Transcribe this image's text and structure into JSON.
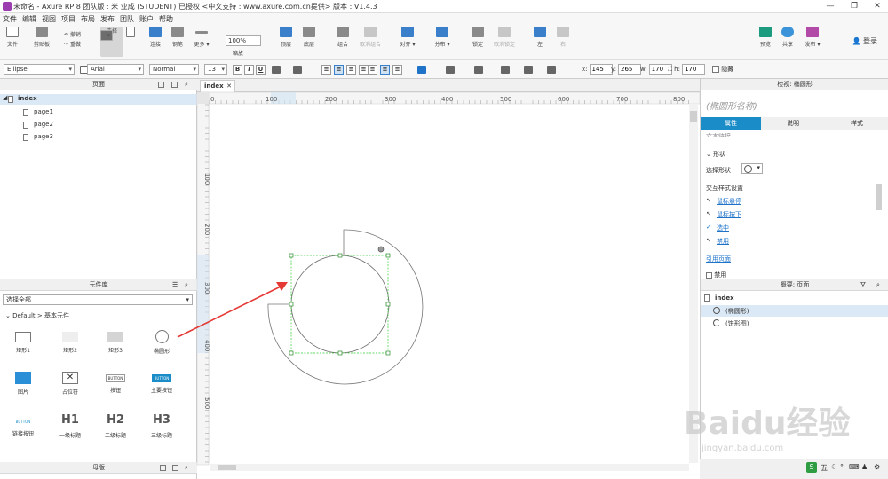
{
  "window": {
    "title": "未命名 - Axure RP 8 团队版 : 米 业成 (STUDENT) 已授权    <中文支持 : www.axure.com.cn提供> 版本 : V1.4.3"
  },
  "menu": [
    "文件",
    "编辑",
    "视图",
    "项目",
    "布局",
    "发布",
    "团队",
    "账户",
    "帮助"
  ],
  "toolbar": {
    "file": "文件",
    "clipboard": "剪贴板",
    "undo": "撤销",
    "redo": "重做",
    "select": "选择",
    "connect": "连接",
    "pen": "钢笔",
    "more": "更多 ▾",
    "zoom_value": "100%",
    "zoom_label": "缩放",
    "top": "顶层",
    "bottom": "底层",
    "group": "组合",
    "ungroup": "取消组合",
    "align": "对齐 ▾",
    "distribute": "分布 ▾",
    "lock": "锁定",
    "unlock": "取消锁定",
    "left": "左",
    "right": "右",
    "preview": "预览",
    "share": "共享",
    "publish": "发布 ▾",
    "login": "登录"
  },
  "style": {
    "widget_type": "Ellipse",
    "font": "Arial",
    "weight": "Normal",
    "size": "13",
    "x_label": "x:",
    "x": "145",
    "y_label": "y:",
    "y": "265",
    "w_label": "w:",
    "w": "170",
    "h_label": "h:",
    "h": "170",
    "hidden": "隐藏"
  },
  "pages": {
    "title": "页面",
    "root": "index",
    "items": [
      "page1",
      "page2",
      "page3"
    ]
  },
  "library": {
    "title": "元件库",
    "select": "选择全部",
    "category": "Default > 基本元件",
    "widgets": [
      "矩形1",
      "矩形2",
      "矩形3",
      "椭圆形",
      "图片",
      "占位符",
      "按钮",
      "主要按钮",
      "链接按钮",
      "一级标题",
      "二级标题",
      "三级标题"
    ],
    "button_text": "BUTTON",
    "h1": "H1",
    "h2": "H2",
    "h3": "H3"
  },
  "masters": {
    "title": "母版"
  },
  "canvas": {
    "tab": "index",
    "ruler_h": [
      "0",
      "100",
      "200",
      "300",
      "400",
      "500",
      "600",
      "700",
      "800"
    ],
    "ruler_v": [
      "100",
      "200",
      "300",
      "400",
      "500"
    ]
  },
  "inspector": {
    "title": "检视: 椭圆形",
    "name_placeholder": "(椭圆形名称)",
    "tabs": [
      "属性",
      "说明",
      "样式"
    ],
    "text_link": "文本链接",
    "shape_section": "形状",
    "select_shape": "选择形状",
    "interaction_title": "交互样式设置",
    "mouse_over": "鼠标悬停",
    "mouse_down": "鼠标按下",
    "selected": "选中",
    "disabled": "禁用",
    "ref_page": "引用页面",
    "disabled_cb": "禁用"
  },
  "outline": {
    "title": "概要: 页面",
    "root": "index",
    "items": [
      "(椭圆形)",
      "(饼形图)"
    ]
  },
  "watermark": {
    "brand": "Baidu经验",
    "url": "jingyan.baidu.com"
  },
  "status": {
    "items": [
      "五",
      "☾",
      "°",
      "⌨",
      "♟",
      "⚙"
    ]
  }
}
